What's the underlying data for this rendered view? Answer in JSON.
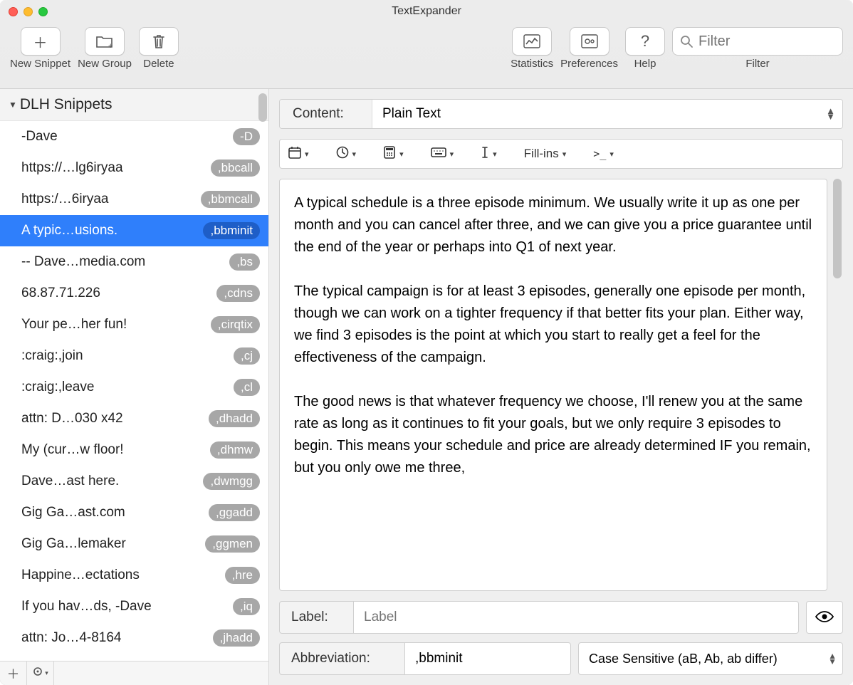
{
  "window": {
    "title": "TextExpander"
  },
  "toolbar": {
    "new_snippet": "New Snippet",
    "new_group": "New Group",
    "delete": "Delete",
    "statistics": "Statistics",
    "preferences": "Preferences",
    "help": "Help",
    "filter_label": "Filter",
    "filter_placeholder": "Filter"
  },
  "sidebar": {
    "group_name": "DLH Snippets",
    "items": [
      {
        "label": "-Dave",
        "badge": "-D"
      },
      {
        "label": "https://…lg6iryaa",
        "badge": ",bbcall"
      },
      {
        "label": "https:/…6iryaa",
        "badge": ",bbmcall"
      },
      {
        "label": "A typic…usions.",
        "badge": ",bbminit",
        "selected": true
      },
      {
        "label": "-- Dave…media.com",
        "badge": ",bs"
      },
      {
        "label": "68.87.71.226",
        "badge": ",cdns"
      },
      {
        "label": "Your pe…her fun!",
        "badge": ",cirqtix"
      },
      {
        "label": ":craig:,join",
        "badge": ",cj"
      },
      {
        "label": ":craig:,leave",
        "badge": ",cl"
      },
      {
        "label": "attn: D…030 x42",
        "badge": ",dhadd"
      },
      {
        "label": "My (cur…w floor!",
        "badge": ",dhmw"
      },
      {
        "label": "Dave…ast here.",
        "badge": ",dwmgg"
      },
      {
        "label": "Gig Ga…ast.com",
        "badge": ",ggadd"
      },
      {
        "label": "Gig Ga…lemaker",
        "badge": ",ggmen"
      },
      {
        "label": "Happine…ectations",
        "badge": ",hre"
      },
      {
        "label": "If you hav…ds, -Dave",
        "badge": ",iq"
      },
      {
        "label": "attn: Jo…4-8164",
        "badge": ",jhadd"
      }
    ]
  },
  "editor": {
    "content_label": "Content:",
    "content_type": "Plain Text",
    "fillins_label": "Fill-ins",
    "body": "A typical schedule is a three episode minimum. We usually write it up as one per month and you can cancel after three, and we can give you a price guarantee until the end of the year or perhaps into Q1 of next year.\n\nThe typical campaign is for at least 3 episodes, generally one episode per month, though we can work on a tighter frequency if that better fits your plan. Either way, we find 3 episodes is the point at which you start to really get a feel for the effectiveness of the campaign.\n\nThe good news is that whatever frequency we choose, I'll renew you at the same rate as long as it continues to fit your goals, but we only require 3 episodes to begin. This means your schedule and price are already determined IF you remain, but you only owe me three,",
    "label_label": "Label:",
    "label_placeholder": "Label",
    "abbrev_label": "Abbreviation:",
    "abbrev_value": ",bbminit",
    "case_mode": "Case Sensitive (aB, Ab, ab differ)"
  }
}
